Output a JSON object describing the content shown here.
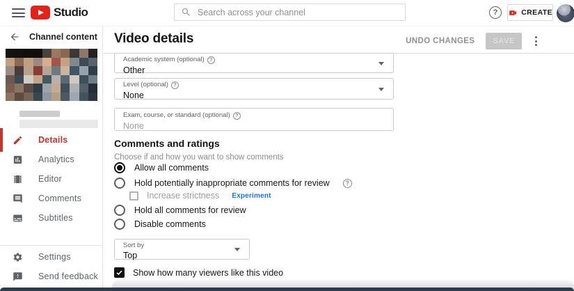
{
  "ui": {
    "help_glyph": "?"
  },
  "header": {
    "logo_text": "Studio",
    "search_placeholder": "Search across your channel",
    "create_label": "CREATE"
  },
  "sidebar": {
    "back_label": "Channel content",
    "items": [
      {
        "label": "Details",
        "active": true
      },
      {
        "label": "Analytics",
        "active": false
      },
      {
        "label": "Editor",
        "active": false
      },
      {
        "label": "Comments",
        "active": false
      },
      {
        "label": "Subtitles",
        "active": false
      }
    ],
    "footer_items": [
      {
        "label": "Settings"
      },
      {
        "label": "Send feedback"
      }
    ],
    "thumbnail_colors": [
      "#141210",
      "#131110",
      "#100f0d",
      "#0f0e0c",
      "#4a423c",
      "#9a7a5e",
      "#8a6751",
      "#3c3835",
      "#8c7866",
      "#242220",
      "#c79e7e",
      "#8a6a55",
      "#c2a07f",
      "#998b83",
      "#d7ae8e",
      "#a2554a",
      "#c79f81",
      "#7d8a92",
      "#3e4a54",
      "#58626c",
      "#998d87",
      "#4a3c38",
      "#b8a08b",
      "#8b3c38",
      "#b5a497",
      "#6e7a82",
      "#c9b4a2",
      "#415664",
      "#97a3ab",
      "#2f3e48",
      "#6b5a50",
      "#3a4a52",
      "#d0cbc4",
      "#c2a488",
      "#44585f",
      "#b8b2aa",
      "#5a6a72",
      "#cfc9c2",
      "#3d5058",
      "#6e7e86",
      "#7a5f50",
      "#8a7464",
      "#584a44",
      "#2e3c44",
      "#9aa4aa",
      "#c5ab92",
      "#404e58",
      "#aab2b6",
      "#52606a",
      "#243038",
      "#8c7360",
      "#5e4c42",
      "#776257",
      "#38464e",
      "#8e989e",
      "#b59e86",
      "#4a5a64",
      "#9ea8ae",
      "#44525c",
      "#2a363e"
    ]
  },
  "main": {
    "title": "Video details",
    "actions": {
      "undo_label": "UNDO CHANGES",
      "save_label": "SAVE"
    },
    "fields": [
      {
        "label": "Academic system (optional)",
        "value": "Other"
      },
      {
        "label": "Level (optional)",
        "value": "None"
      },
      {
        "label": "Exam, course, or standard (optional)",
        "value": "None"
      }
    ],
    "comments": {
      "title": "Comments and ratings",
      "subtitle": "Choose if and how you want to show comments",
      "options": [
        {
          "label": "Allow all comments",
          "selected": true
        },
        {
          "label": "Hold potentially inappropriate comments for review",
          "selected": false
        },
        {
          "label": "Hold all comments for review",
          "selected": false
        },
        {
          "label": "Disable comments",
          "selected": false
        }
      ],
      "strictness": {
        "label": "Increase strictness",
        "badge": "Experiment",
        "checked": false
      },
      "sort": {
        "label": "Sort by",
        "value": "Top"
      },
      "likes": {
        "label": "Show how many viewers like this video",
        "checked": true
      }
    }
  },
  "colors": {
    "brand_red": "#e62117",
    "active_item_red": "#c0362c",
    "experiment_blue": "#1a73e8"
  }
}
